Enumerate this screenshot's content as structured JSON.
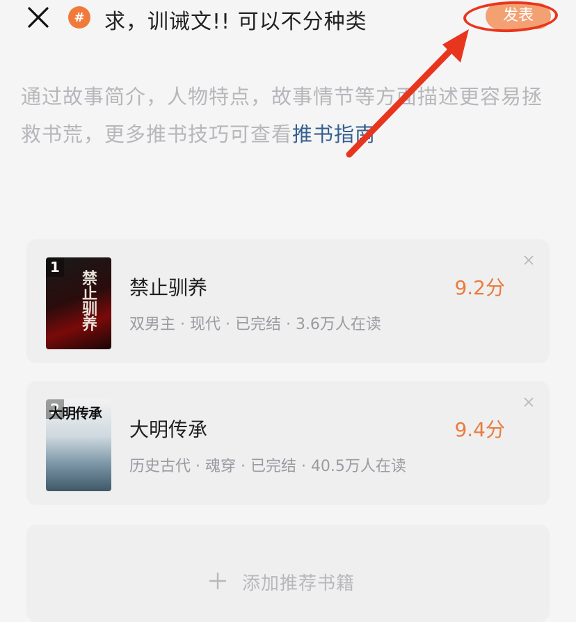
{
  "header": {
    "topic_symbol": "#",
    "title": "求，训诫文!! 可以不分种类",
    "publish_label": "发表"
  },
  "hint": {
    "text": "通过故事简介，人物特点，故事情节等方面描述更容易拯救书荒，更多推书技巧可查看",
    "link_text": "推书指南"
  },
  "books": [
    {
      "rank": "1",
      "cover_text": "禁止驯养",
      "title": "禁止驯养",
      "meta": "双男主 · 现代 · 已完结 · 3.6万人在读",
      "score": "9.2分"
    },
    {
      "rank": "2",
      "cover_text": "大明传承",
      "title": "大明传承",
      "meta": "历史古代 · 魂穿 · 已完结 · 40.5万人在读",
      "score": "9.4分"
    }
  ],
  "add_book": {
    "label": "添加推荐书籍"
  },
  "colors": {
    "accent": "#f07a3a",
    "publish_bg": "#f3a173",
    "annotation_red": "#e8361e",
    "link": "#355f8f",
    "score": "#e97c3e"
  },
  "icons": {
    "close": "close-icon",
    "topic": "hashtag-icon",
    "remove": "close-small-icon",
    "add": "plus-icon"
  }
}
